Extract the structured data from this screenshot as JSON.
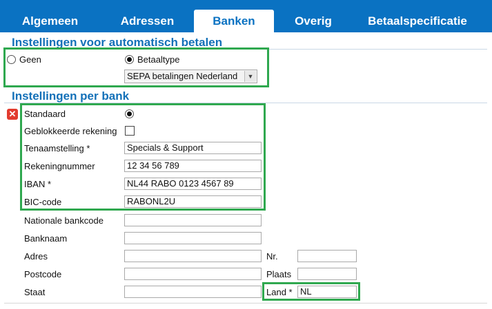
{
  "tabs": [
    {
      "label": "Algemeen"
    },
    {
      "label": "Adressen"
    },
    {
      "label": "Banken"
    },
    {
      "label": "Overig"
    },
    {
      "label": "Betaalspecificatie"
    }
  ],
  "auto_payment": {
    "title": "Instellingen voor automatisch betalen",
    "option_none": "Geen",
    "option_paytype": "Betaaltype",
    "selected_option": "Betaaltype",
    "paytype_value": "SEPA betalingen Nederland"
  },
  "bank": {
    "title": "Instellingen per bank",
    "error_icon": "error-x-icon",
    "standaard_label": "Standaard",
    "standaard_checked": true,
    "geblokkeerd_label": "Geblokkeerde rekening",
    "geblokkeerd_checked": false,
    "tenaamstelling_label": "Tenaamstelling *",
    "tenaamstelling_value": "Specials & Support",
    "rekeningnummer_label": "Rekeningnummer",
    "rekeningnummer_value": "12 34 56 789",
    "iban_label": "IBAN *",
    "iban_value": "NL44 RABO 0123 4567 89",
    "bic_label": "BIC-code",
    "bic_value": "RABONL2U",
    "nationale_label": "Nationale bankcode",
    "nationale_value": "",
    "banknaam_label": "Banknaam",
    "banknaam_value": "",
    "adres_label": "Adres",
    "adres_value": "",
    "nr_label": "Nr.",
    "nr_value": "",
    "postcode_label": "Postcode",
    "postcode_value": "",
    "plaats_label": "Plaats",
    "plaats_value": "",
    "staat_label": "Staat",
    "staat_value": "",
    "land_label": "Land *",
    "land_value": "NL"
  },
  "colors": {
    "tab_bar": "#0a72c2",
    "section_title": "#1370b8",
    "highlight": "#2fa84f",
    "error": "#e23b2e"
  }
}
